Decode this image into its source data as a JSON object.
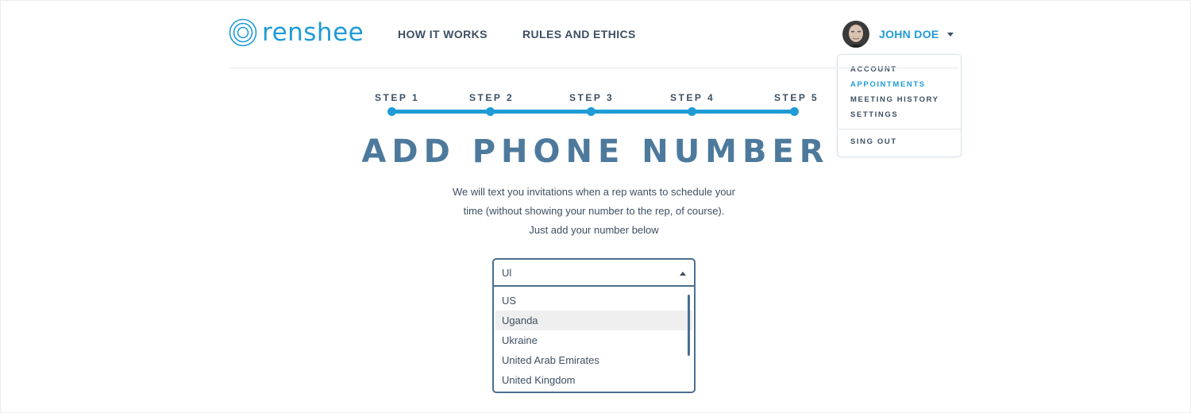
{
  "brand": {
    "name": "renshee",
    "color": "#1f9bd6"
  },
  "nav": {
    "how_it_works": "HOW IT WORKS",
    "rules_and_ethics": "RULES AND ETHICS"
  },
  "user": {
    "name": "JOHN DOE",
    "menu": {
      "account": "ACCOUNT",
      "appointments": "APPOINTMENTS",
      "meeting_history": "MEETING HISTORY",
      "settings": "SETTINGS",
      "sign_out": "SING OUT"
    }
  },
  "steps": [
    "STEP 1",
    "STEP 2",
    "STEP 3",
    "STEP 4",
    "STEP 5"
  ],
  "title": "ADD PHONE NUMBER",
  "description": "We will text you invitations when a rep wants to schedule your time (without showing your number to the rep, of course). Just add your number below",
  "country_select": {
    "typed_value": "Ul",
    "options": [
      "US",
      "Uganda",
      "Ukraine",
      "United Arab Emirates",
      "United Kingdom"
    ],
    "highlighted": "Uganda"
  },
  "colors": {
    "accent": "#1f9bd6",
    "text_dark": "#3d4f63",
    "title": "#4d7a9c",
    "border": "#4a6f8f"
  }
}
